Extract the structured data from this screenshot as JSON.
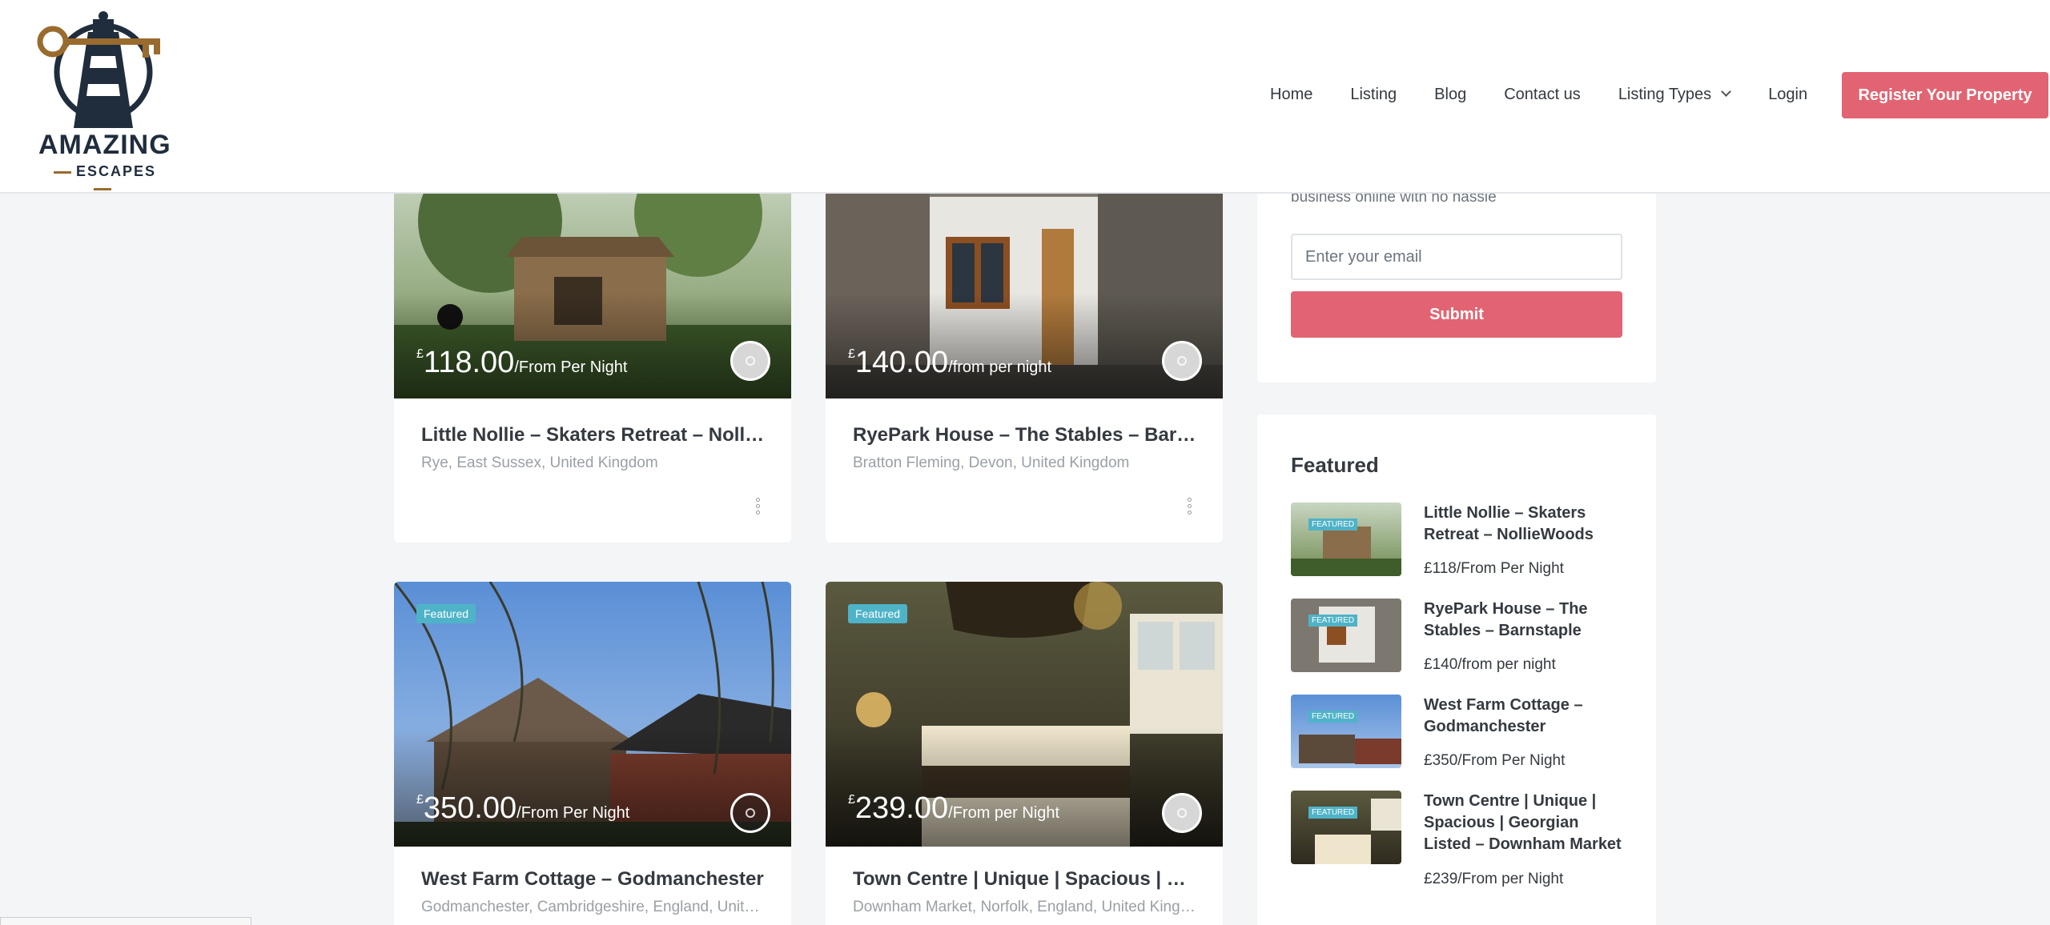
{
  "logo": {
    "line1": "AMAZING",
    "line2": "ESCAPES",
    "colors": {
      "navy": "#1f2d3d",
      "gold": "#9a6b2e"
    }
  },
  "nav": {
    "items": [
      "Home",
      "Listing",
      "Blog",
      "Contact us",
      "Listing Types"
    ],
    "login": "Login",
    "register": "Register Your Property"
  },
  "accent_color": "#e26472",
  "badge_color": "#4fb3c8",
  "listings": [
    {
      "currency": "£",
      "price": "118.00",
      "unit": "/From Per Night",
      "title": "Little Nollie – Skaters Retreat – NollieWoods",
      "location": "Rye, East Sussex, United Kingdom",
      "badge": ""
    },
    {
      "currency": "£",
      "price": "140.00",
      "unit": "/from per night",
      "title": "RyePark House – The Stables – Barnstaple",
      "location": "Bratton Fleming, Devon, United Kingdom",
      "badge": ""
    },
    {
      "currency": "£",
      "price": "350.00",
      "unit": "/From Per Night",
      "title": "West Farm Cottage – Godmanchester",
      "location": "Godmanchester, Cambridgeshire, England, United Kingdom",
      "badge": "Featured"
    },
    {
      "currency": "£",
      "price": "239.00",
      "unit": "/From per Night",
      "title": "Town Centre | Unique | Spacious | Georgian Listed – Downham Market",
      "location": "Downham Market, Norfolk, England, United Kingdom",
      "badge": "Featured"
    }
  ],
  "newsletter": {
    "text": "business online with no hassle",
    "placeholder": "Enter your email",
    "submit": "Submit"
  },
  "featured": {
    "title": "Featured",
    "badge": "FEATURED",
    "items": [
      {
        "name": "Little Nollie – Skaters Retreat – NollieWoods",
        "price": "£118/From Per Night"
      },
      {
        "name": "RyePark House – The Stables – Barnstaple",
        "price": "£140/from per night"
      },
      {
        "name": "West Farm Cottage – Godmanchester",
        "price": "£350/From Per Night"
      },
      {
        "name": "Town Centre | Unique | Spacious | Georgian Listed – Downham Market",
        "price": "£239/From per Night"
      }
    ]
  }
}
